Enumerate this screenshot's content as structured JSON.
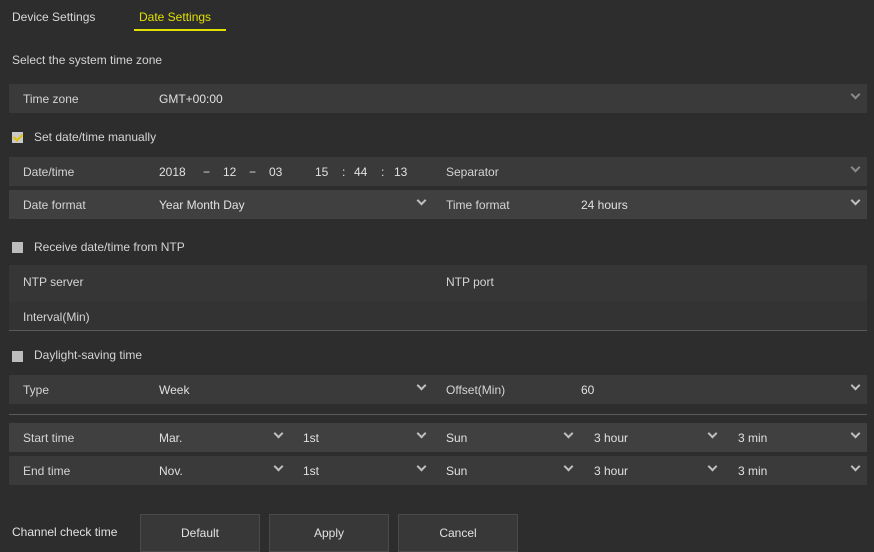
{
  "tabs": {
    "device": "Device Settings",
    "date": "Date Settings"
  },
  "timezone_section": {
    "label": "Select the system time zone"
  },
  "timezone": {
    "label": "Time zone",
    "value": "GMT+00:00"
  },
  "manual": {
    "checkbox_label": "Set date/time manually",
    "checked": true,
    "datetime_label": "Date/time",
    "year": "2018",
    "sep1": "−",
    "month": "12",
    "sep2": "−",
    "day": "03",
    "hour": "15",
    "col1": ":",
    "minute": "44",
    "col2": ":",
    "second": "13",
    "separator_label": "Separator",
    "date_format_label": "Date format",
    "date_format_value": "Year Month Day",
    "time_format_label": "Time format",
    "time_format_value": "24 hours"
  },
  "ntp": {
    "checkbox_label": "Receive date/time from NTP",
    "checked": false,
    "server_label": "NTP server",
    "port_label": "NTP port",
    "interval_label": "Interval(Min)"
  },
  "dst": {
    "checkbox_label": "Daylight-saving time",
    "checked": false,
    "type_label": "Type",
    "type_value": "Week",
    "offset_label": "Offset(Min)",
    "offset_value": "60",
    "start": {
      "label": "Start time",
      "month": "Mar.",
      "week": "1st",
      "day": "Sun",
      "hour": "3 hour",
      "min": "3 min"
    },
    "end": {
      "label": "End time",
      "month": "Nov.",
      "week": "1st",
      "day": "Sun",
      "hour": "3 hour",
      "min": "3 min"
    }
  },
  "buttons": {
    "channel_check": "Channel check time",
    "default": "Default",
    "apply": "Apply",
    "cancel": "Cancel"
  },
  "colors": {
    "accent": "#e2e000",
    "background": "#2d2d2d",
    "row": "#3a3a3a"
  }
}
